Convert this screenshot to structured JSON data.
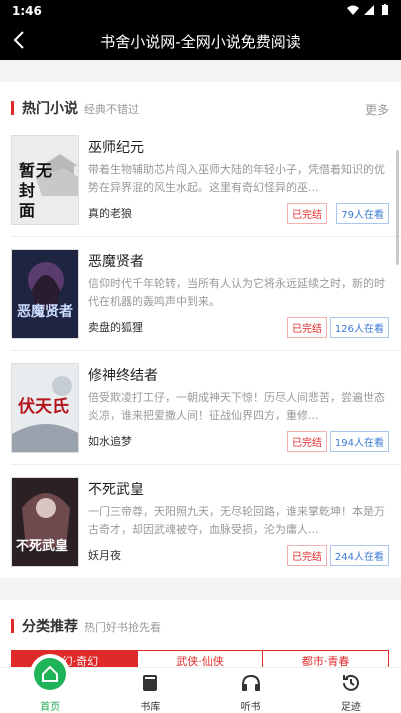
{
  "status_bar": {
    "time": "1:46"
  },
  "header": {
    "title": "书舍小说网-全网小说免费阅读"
  },
  "hot_section": {
    "title": "热门小说",
    "subtitle": "经典不错过",
    "more": "更多",
    "books": [
      {
        "name": "巫师纪元",
        "desc": "带着生物辅助芯片闯入巫师大陆的年轻小子，凭借着知识的优势在异界混的风生水起。这里有奇幻怪异的巫...",
        "author": "真的老狼",
        "status": "已完结",
        "readers": "79人在看",
        "cover_text": "暂无封面"
      },
      {
        "name": "恶魔贤者",
        "desc": "信仰时代千年轮转，当所有人认为它将永远延续之时，新的时代在机器的轰鸣声中到来。",
        "author": "卖盘的狐狸",
        "status": "已完结",
        "readers": "126人在看",
        "cover_text": "恶魔贤者"
      },
      {
        "name": "修神终结者",
        "desc": "倍受欺凌打工仔，一朝成神天下惊！历尽人间悲苦，尝遍世态炎凉，谁来把爱撒人间！征战仙界四方，重修...",
        "author": "如水追梦",
        "status": "已完结",
        "readers": "194人在看",
        "cover_text": "伏天氏"
      },
      {
        "name": "不死武皇",
        "desc": "一门三帝尊，天阳照九天，无尽轮回路，谁来掌乾坤！本是万古奇才，却因武魂被夺，血脉受损，沦为庸人...",
        "author": "妖月夜",
        "status": "已完结",
        "readers": "244人在看",
        "cover_text": "不死武皇"
      }
    ]
  },
  "category_section": {
    "title": "分类推荐",
    "subtitle": "热门好书抢先看",
    "tabs": [
      "玄幻·奇幻",
      "武侠·仙侠",
      "都市·青春"
    ]
  },
  "tabbar": {
    "items": [
      {
        "label": "首页",
        "icon": "home-icon"
      },
      {
        "label": "书库",
        "icon": "library-icon"
      },
      {
        "label": "听书",
        "icon": "headphones-icon"
      },
      {
        "label": "足迹",
        "icon": "history-icon"
      }
    ]
  },
  "colors": {
    "accent": "#e02a2a",
    "tab_active": "#1aa84f"
  }
}
